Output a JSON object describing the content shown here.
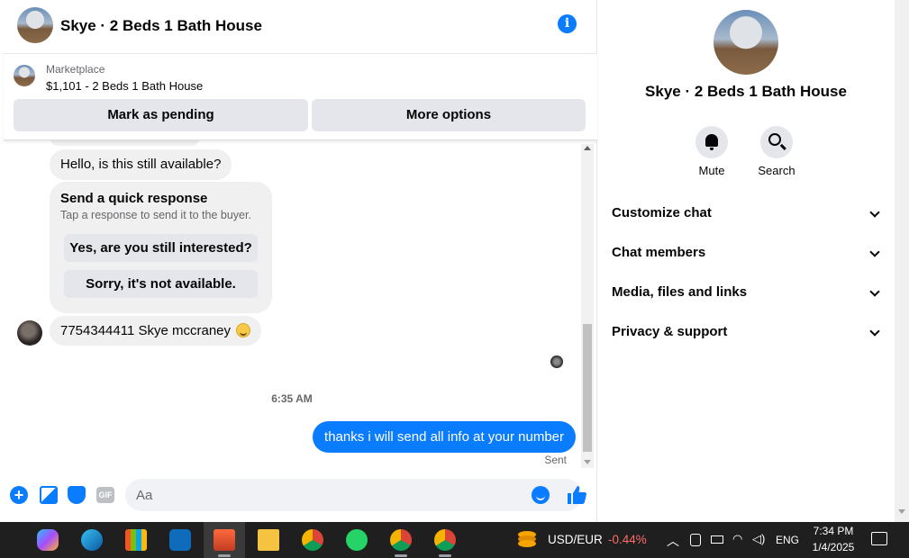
{
  "chat": {
    "title": "Skye · 2 Beds 1 Bath House",
    "marketplace": {
      "label": "Marketplace",
      "listing": "$1,101 - 2 Beds 1 Bath House",
      "pending_button": "Mark as pending",
      "more_button": "More options"
    },
    "messages": {
      "hello": "Hello, is this still available?",
      "quick_title": "Send a quick response",
      "quick_subtitle": "Tap a response to send it to the buyer.",
      "quick_replies": [
        "Yes, are you still interested?",
        "Sorry, it's not available."
      ],
      "phone_message": "7754344411 Skye mccraney",
      "timestamp": "6:35 AM",
      "outgoing": "thanks i will send all info at your number",
      "status": "Sent"
    },
    "composer": {
      "placeholder": "Aa",
      "gif_label": "GIF",
      "plus_symbol": "+"
    },
    "info_symbol": "i",
    "accent_color": "#0a7cff"
  },
  "details": {
    "title": "Skye · 2 Beds 1 Bath House",
    "actions": {
      "mute": "Mute",
      "search": "Search"
    },
    "sections": [
      "Customize chat",
      "Chat members",
      "Media, files and links",
      "Privacy & support"
    ]
  },
  "taskbar": {
    "ticker_pair": "USD/EUR",
    "ticker_change": "-0.44%",
    "language": "ENG",
    "time": "7:34 PM",
    "date": "1/4/2025",
    "apps": [
      "copilot-icon",
      "edge-icon",
      "store-icon",
      "outlook-icon",
      "app-icon",
      "file-explorer-icon",
      "chrome-icon",
      "whatsapp-icon",
      "chrome-profile-icon",
      "chrome-profile2-icon"
    ]
  }
}
